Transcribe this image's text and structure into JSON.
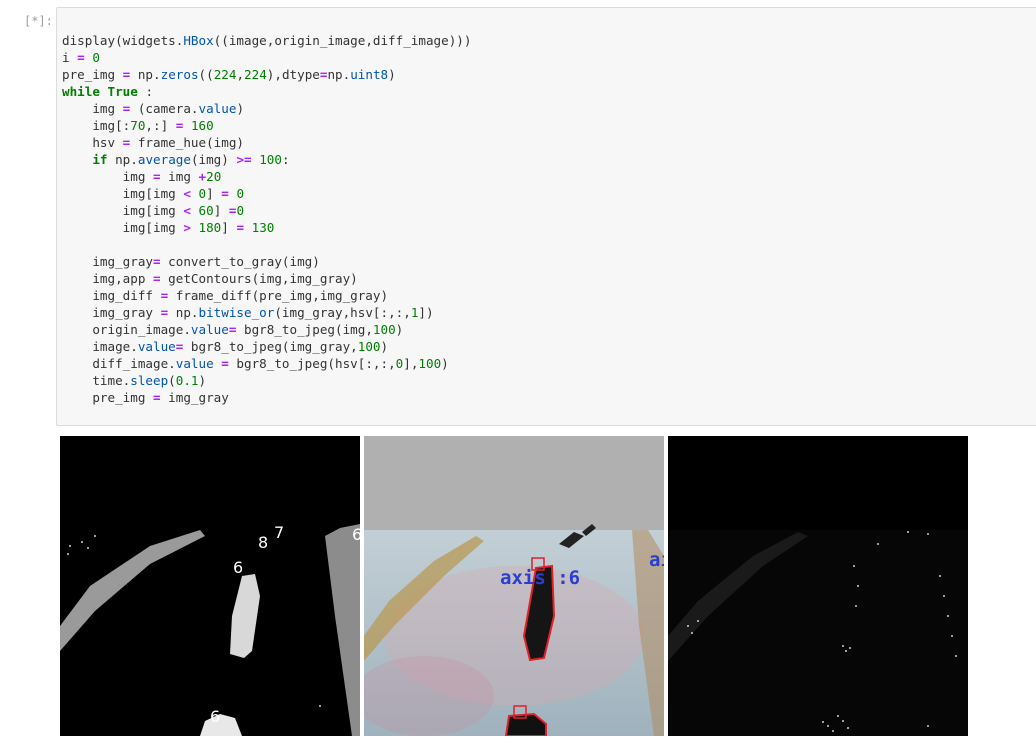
{
  "prompt": "[*]:",
  "code_lines": [
    [
      {
        "t": "display(widgets."
      },
      {
        "t": "HBox",
        "c": "attr"
      },
      {
        "t": "((image,origin_image,diff_image)))"
      }
    ],
    [
      {
        "t": "i "
      },
      {
        "t": "=",
        "c": "op"
      },
      {
        "t": " "
      },
      {
        "t": "0",
        "c": "num"
      }
    ],
    [
      {
        "t": "pre_img "
      },
      {
        "t": "=",
        "c": "op"
      },
      {
        "t": " np."
      },
      {
        "t": "zeros",
        "c": "attr"
      },
      {
        "t": "(("
      },
      {
        "t": "224",
        "c": "num"
      },
      {
        "t": ","
      },
      {
        "t": "224",
        "c": "num"
      },
      {
        "t": "),dtype"
      },
      {
        "t": "=",
        "c": "op"
      },
      {
        "t": "np."
      },
      {
        "t": "uint8",
        "c": "attr"
      },
      {
        "t": ")"
      }
    ],
    [
      {
        "t": "while",
        "c": "kw"
      },
      {
        "t": " "
      },
      {
        "t": "True",
        "c": "kw"
      },
      {
        "t": " :"
      }
    ],
    [
      {
        "t": "    img "
      },
      {
        "t": "=",
        "c": "op"
      },
      {
        "t": " (camera."
      },
      {
        "t": "value",
        "c": "attr"
      },
      {
        "t": ")"
      }
    ],
    [
      {
        "t": "    img[:"
      },
      {
        "t": "70",
        "c": "num"
      },
      {
        "t": ",:] "
      },
      {
        "t": "=",
        "c": "op"
      },
      {
        "t": " "
      },
      {
        "t": "160",
        "c": "num"
      }
    ],
    [
      {
        "t": "    hsv "
      },
      {
        "t": "=",
        "c": "op"
      },
      {
        "t": " frame_hue(img)"
      }
    ],
    [
      {
        "t": "    "
      },
      {
        "t": "if",
        "c": "kw"
      },
      {
        "t": " np."
      },
      {
        "t": "average",
        "c": "attr"
      },
      {
        "t": "(img) "
      },
      {
        "t": ">=",
        "c": "op"
      },
      {
        "t": " "
      },
      {
        "t": "100",
        "c": "num"
      },
      {
        "t": ":"
      }
    ],
    [
      {
        "t": "        img "
      },
      {
        "t": "=",
        "c": "op"
      },
      {
        "t": " img "
      },
      {
        "t": "+",
        "c": "op"
      },
      {
        "t": "20",
        "c": "num"
      }
    ],
    [
      {
        "t": "        img[img "
      },
      {
        "t": "<",
        "c": "op"
      },
      {
        "t": " "
      },
      {
        "t": "0",
        "c": "num"
      },
      {
        "t": "] "
      },
      {
        "t": "=",
        "c": "op"
      },
      {
        "t": " "
      },
      {
        "t": "0",
        "c": "num"
      }
    ],
    [
      {
        "t": "        img[img "
      },
      {
        "t": "<",
        "c": "op"
      },
      {
        "t": " "
      },
      {
        "t": "60",
        "c": "num"
      },
      {
        "t": "] "
      },
      {
        "t": "=",
        "c": "op"
      },
      {
        "t": "0",
        "c": "num"
      }
    ],
    [
      {
        "t": "        img[img "
      },
      {
        "t": ">",
        "c": "op"
      },
      {
        "t": " "
      },
      {
        "t": "180",
        "c": "num"
      },
      {
        "t": "] "
      },
      {
        "t": "=",
        "c": "op"
      },
      {
        "t": " "
      },
      {
        "t": "130",
        "c": "num"
      }
    ],
    [
      {
        "t": ""
      }
    ],
    [
      {
        "t": "    img_gray"
      },
      {
        "t": "=",
        "c": "op"
      },
      {
        "t": " convert_to_gray(img)"
      }
    ],
    [
      {
        "t": "    img,app "
      },
      {
        "t": "=",
        "c": "op"
      },
      {
        "t": " getContours(img,img_gray)"
      }
    ],
    [
      {
        "t": "    img_diff "
      },
      {
        "t": "=",
        "c": "op"
      },
      {
        "t": " frame_diff(pre_img,img_gray)"
      }
    ],
    [
      {
        "t": "    img_gray "
      },
      {
        "t": "=",
        "c": "op"
      },
      {
        "t": " np."
      },
      {
        "t": "bitwise_or",
        "c": "attr"
      },
      {
        "t": "(img_gray,hsv[:,:,"
      },
      {
        "t": "1",
        "c": "num"
      },
      {
        "t": "])"
      }
    ],
    [
      {
        "t": "    origin_image."
      },
      {
        "t": "value",
        "c": "attr"
      },
      {
        "t": "=",
        "c": "op"
      },
      {
        "t": " bgr8_to_jpeg(img,"
      },
      {
        "t": "100",
        "c": "num"
      },
      {
        "t": ")"
      }
    ],
    [
      {
        "t": "    image."
      },
      {
        "t": "value",
        "c": "attr"
      },
      {
        "t": "=",
        "c": "op"
      },
      {
        "t": " bgr8_to_jpeg(img_gray,"
      },
      {
        "t": "100",
        "c": "num"
      },
      {
        "t": ")"
      }
    ],
    [
      {
        "t": "    diff_image."
      },
      {
        "t": "value",
        "c": "attr"
      },
      {
        "t": " "
      },
      {
        "t": "=",
        "c": "op"
      },
      {
        "t": " bgr8_to_jpeg(hsv[:,:,"
      },
      {
        "t": "0",
        "c": "num"
      },
      {
        "t": "],"
      },
      {
        "t": "100",
        "c": "num"
      },
      {
        "t": ")"
      }
    ],
    [
      {
        "t": "    time."
      },
      {
        "t": "sleep",
        "c": "attr"
      },
      {
        "t": "("
      },
      {
        "t": "0.1",
        "c": "num"
      },
      {
        "t": ")"
      }
    ],
    [
      {
        "t": "    pre_img "
      },
      {
        "t": "=",
        "c": "op"
      },
      {
        "t": " img_gray"
      }
    ]
  ],
  "images": {
    "gray_labels": [
      "6",
      "8",
      "7",
      "6",
      "6",
      "6"
    ],
    "origin_labels": {
      "axis_text": "axis :6",
      "edge_text": "ai"
    }
  },
  "colors": {
    "cell_bg": "#f7f7f7",
    "cell_border": "#dcdcdc",
    "keyword": "#008000",
    "number": "#008000",
    "operator": "#aa22ff",
    "attribute": "#0055aa",
    "contour_red": "#e0202a",
    "axis_blue": "#2a3fd0"
  }
}
